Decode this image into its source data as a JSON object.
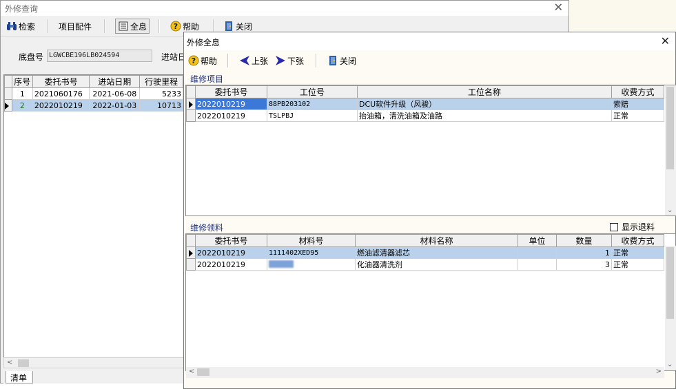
{
  "back_window": {
    "title": "外修查询",
    "toolbar": {
      "search_label": "检索",
      "items_parts_label": "项目配件",
      "full_info_label": "全息",
      "help_label": "帮助",
      "close_label": "关闭"
    },
    "chassis_label": "底盘号",
    "chassis_value": "LGWCBE196LB024594",
    "entry_date_label": "进站日",
    "grid": {
      "columns": [
        "序号",
        "委托书号",
        "进站日期",
        "行驶里程"
      ],
      "rows": [
        {
          "seq": "1",
          "order_no": "2021060176",
          "date": "2021-06-08",
          "mileage": "5233"
        },
        {
          "seq": "2",
          "order_no": "2022010219",
          "date": "2022-01-03",
          "mileage": "10713"
        }
      ]
    },
    "tab_label": "清单"
  },
  "front_window": {
    "title": "外修全息",
    "toolbar": {
      "help_label": "帮助",
      "prev_label": "上张",
      "next_label": "下张",
      "close_label": "关闭"
    },
    "repair_items": {
      "section_label": "维修项目",
      "columns": [
        "委托书号",
        "工位号",
        "工位名称",
        "收费方式"
      ],
      "rows": [
        {
          "order_no": "2022010219",
          "station_no": "88PB203102",
          "station_name": "DCU软件升级（风骏）",
          "charge": "索赔"
        },
        {
          "order_no": "2022010219",
          "station_no": "TSLPBJ",
          "station_name": "抬油箱，清洗油箱及油路",
          "charge": "正常"
        }
      ]
    },
    "repair_materials": {
      "section_label": "维修领料",
      "show_returns_label": "显示退料",
      "columns": [
        "委托书号",
        "材料号",
        "材料名称",
        "单位",
        "数量",
        "收费方式"
      ],
      "rows": [
        {
          "order_no": "2022010219",
          "material_no": "1111402XED95",
          "material_name": "燃油滤清器滤芯",
          "unit": "",
          "qty": "1",
          "charge": "正常"
        },
        {
          "order_no": "2022010219",
          "material_no": "",
          "material_name": "化油器清洗剂",
          "unit": "",
          "qty": "3",
          "charge": "正常"
        }
      ]
    }
  },
  "colors": {
    "selection": "#b9d1ea",
    "highlight": "#3b78d8",
    "section_label": "#1d2f7a"
  }
}
